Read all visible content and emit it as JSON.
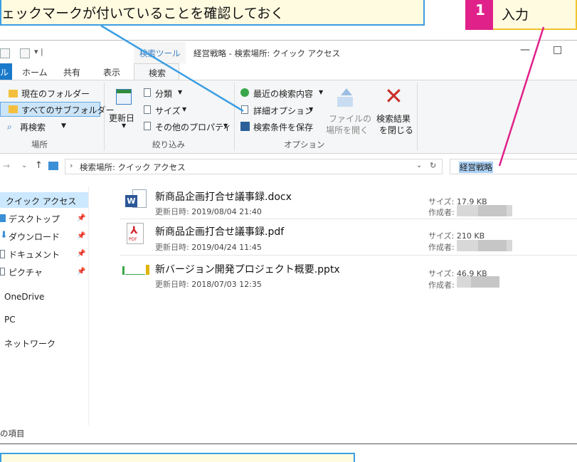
{
  "callouts": {
    "top_text": "ェックマークが付いていることを確認しておく",
    "step_number": "1",
    "step_text": "入力",
    "accent_blue": "#3b9ee4",
    "accent_pink": "#e0218a"
  },
  "window": {
    "context_tab": "検索ツール",
    "title": "経営戦略 - 検索場所: クイック アクセス",
    "minimize": "—",
    "maximize": "□"
  },
  "ribbon_tabs": {
    "file": "ル",
    "home": "ホーム",
    "share": "共有",
    "view": "表示",
    "search": "検索"
  },
  "ribbon": {
    "current_folder": "現在のフォルダー",
    "all_subfolders": "すべてのサブフォルダー",
    "re_search": "再検索",
    "group_location": "場所",
    "modified_date": "更新日",
    "kind": "分類",
    "size": "サイズ",
    "other_props": "その他のプロパティ",
    "group_refine": "絞り込み",
    "recent_searches": "最近の検索内容",
    "advanced_options": "詳細オプション",
    "save_search": "検索条件を保存",
    "open_file_location_1": "ファイルの",
    "open_file_location_2": "場所を開く",
    "group_options": "オプション",
    "close_search_1": "検索結果",
    "close_search_2": "を閉じる"
  },
  "address": {
    "path": "検索場所: クイック アクセス",
    "search_value": "経営戦略"
  },
  "nav": {
    "quick_access": "クイック アクセス",
    "desktop": "デスクトップ",
    "downloads": "ダウンロード",
    "documents": "ドキュメント",
    "pictures": "ピクチャ",
    "onedrive": "OneDrive",
    "pc": "PC",
    "network": "ネットワーク"
  },
  "files": [
    {
      "name": "新商品企画打合せ議事録.docx",
      "modified_label": "更新日時:",
      "modified": "2019/08/04 21:40",
      "size_label": "サイズ:",
      "size": "17.9 KB",
      "author_label": "作成者:"
    },
    {
      "name": "新商品企画打合せ議事録.pdf",
      "modified_label": "更新日時:",
      "modified": "2019/04/24 11:45",
      "size_label": "サイズ:",
      "size": "210 KB",
      "author_label": "作成者:"
    },
    {
      "name": "新バージョン開発プロジェクト概要.pptx",
      "modified_label": "更新日時:",
      "modified": "2018/07/03 12:35",
      "size_label": "サイズ:",
      "size": "46.9 KB",
      "author_label": "作成者:"
    }
  ],
  "status": {
    "items": "の項目"
  }
}
